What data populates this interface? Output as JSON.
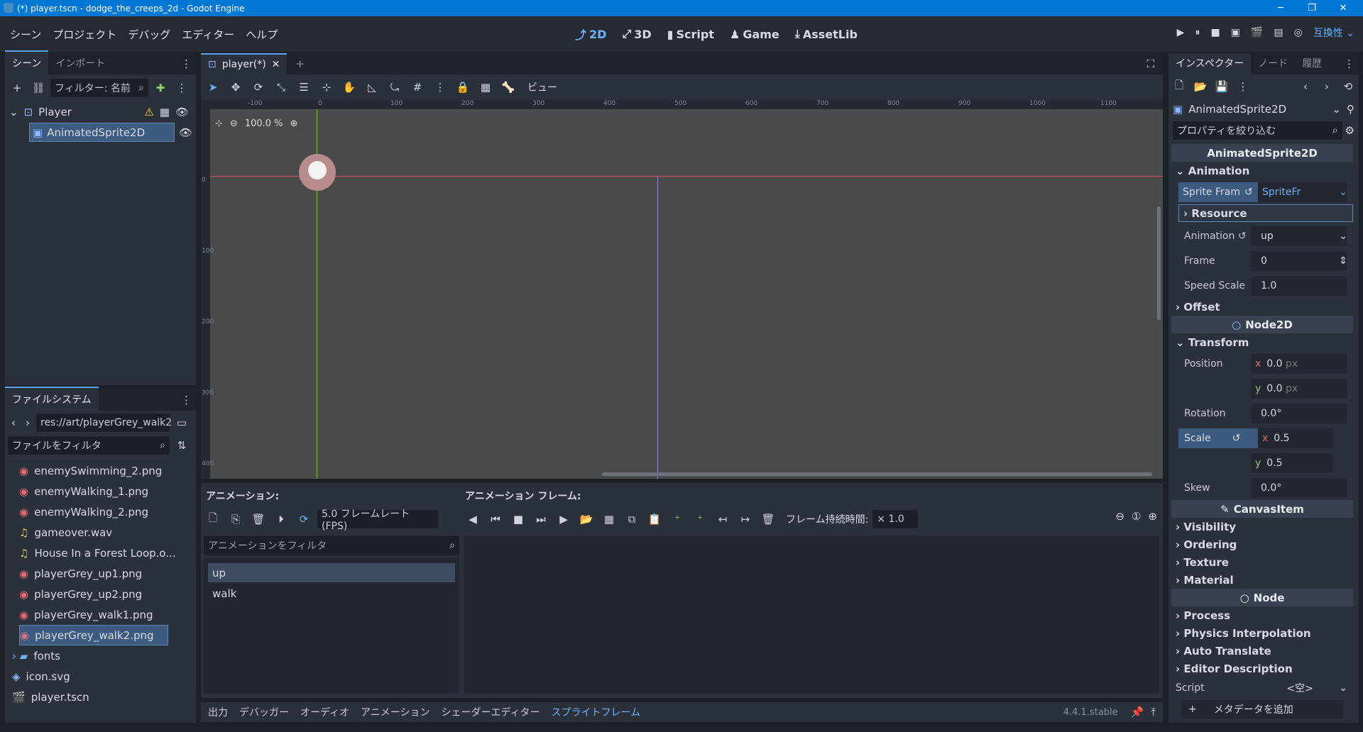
{
  "window": {
    "title": "(*) player.tscn - dodge_the_creeps_2d - Godot Engine",
    "minimize": "─",
    "maximize": "❐",
    "close": "✕"
  },
  "menu": [
    "シーン",
    "プロジェクト",
    "デバッグ",
    "エディター",
    "ヘルプ"
  ],
  "workspaces": [
    {
      "label": "2D",
      "icon": "⤴",
      "active": true
    },
    {
      "label": "3D",
      "icon": "⤢",
      "active": false
    },
    {
      "label": "Script",
      "icon": "▮",
      "active": false
    },
    {
      "label": "Game",
      "icon": "♟",
      "active": false
    },
    {
      "label": "AssetLib",
      "icon": "⤓",
      "active": false
    }
  ],
  "run": {
    "compat": "互換性"
  },
  "scene_dock": {
    "tabs": [
      "シーン",
      "インポート"
    ],
    "filter_placeholder": "フィルター: 名前",
    "nodes": [
      {
        "name": "Player"
      },
      {
        "name": "AnimatedSprite2D"
      }
    ]
  },
  "filesystem": {
    "tab": "ファイルシステム",
    "path": "res://art/playerGrey_walk2",
    "filter_placeholder": "ファイルをフィルタ",
    "items": [
      {
        "name": "enemySwimming_2.png",
        "kind": "image"
      },
      {
        "name": "enemyWalking_1.png",
        "kind": "image"
      },
      {
        "name": "enemyWalking_2.png",
        "kind": "image"
      },
      {
        "name": "gameover.wav",
        "kind": "audio"
      },
      {
        "name": "House In a Forest Loop.o...",
        "kind": "audio"
      },
      {
        "name": "playerGrey_up1.png",
        "kind": "image"
      },
      {
        "name": "playerGrey_up2.png",
        "kind": "image"
      },
      {
        "name": "playerGrey_walk1.png",
        "kind": "image"
      },
      {
        "name": "playerGrey_walk2.png",
        "kind": "image",
        "selected": true
      },
      {
        "name": "fonts",
        "kind": "folder"
      },
      {
        "name": "icon.svg",
        "kind": "svg"
      },
      {
        "name": "player.tscn",
        "kind": "scene"
      }
    ]
  },
  "editor": {
    "tab": "player(*)",
    "view_menu": "ビュー",
    "zoom": "100.0 %",
    "ruler_top": [
      "-100",
      "0",
      "100",
      "200",
      "300",
      "400",
      "500",
      "600",
      "700",
      "800",
      "900",
      "1000",
      "1100"
    ],
    "ruler_left": [
      "0",
      "100",
      "200",
      "300",
      "400"
    ]
  },
  "sprite_frames": {
    "anim_label": "アニメーション:",
    "frames_label": "アニメーション フレーム:",
    "fps": "5.0 フレームレート(FPS)",
    "filter_placeholder": "アニメーションをフィルタ",
    "animations": [
      "up",
      "walk"
    ],
    "frame_duration_label": "フレーム持続時間:",
    "frame_duration": "× 1.0"
  },
  "bottom_tabs": [
    "出力",
    "デバッガー",
    "オーディオ",
    "アニメーション",
    "シェーダーエディター",
    "スプライトフレーム"
  ],
  "version": "4.4.1.stable",
  "inspector": {
    "tabs": [
      "インスペクター",
      "ノード",
      "履歴"
    ],
    "object": "AnimatedSprite2D",
    "filter_placeholder": "プロパティを絞り込む",
    "sections": {
      "animated": "AnimatedSprite2D",
      "node2d": "Node2D",
      "canvas": "CanvasItem",
      "node": "Node"
    },
    "animation_group": "Animation",
    "sprite_frames_label": "Sprite Fram",
    "sprite_frames_value": "SpriteFr",
    "resource": "Resource",
    "animation_label": "Animation",
    "animation_value": "up",
    "frame_label": "Frame",
    "frame_value": "0",
    "speed_label": "Speed Scale",
    "speed_value": "1.0",
    "offset": "Offset",
    "transform": "Transform",
    "position_label": "Position",
    "pos_x": "0.0",
    "pos_y": "0.0",
    "unit_px": "px",
    "rotation_label": "Rotation",
    "rotation_value": "0.0",
    "deg": "°",
    "scale_label": "Scale",
    "scale_x": "0.5",
    "scale_y": "0.5",
    "skew_label": "Skew",
    "skew_value": "0.0",
    "canvas_groups": [
      "Visibility",
      "Ordering",
      "Texture",
      "Material"
    ],
    "node_groups": [
      "Process",
      "Physics Interpolation",
      "Auto Translate",
      "Editor Description"
    ],
    "script_label": "Script",
    "script_value": "<空>",
    "add_metadata": "メタデータを追加"
  }
}
